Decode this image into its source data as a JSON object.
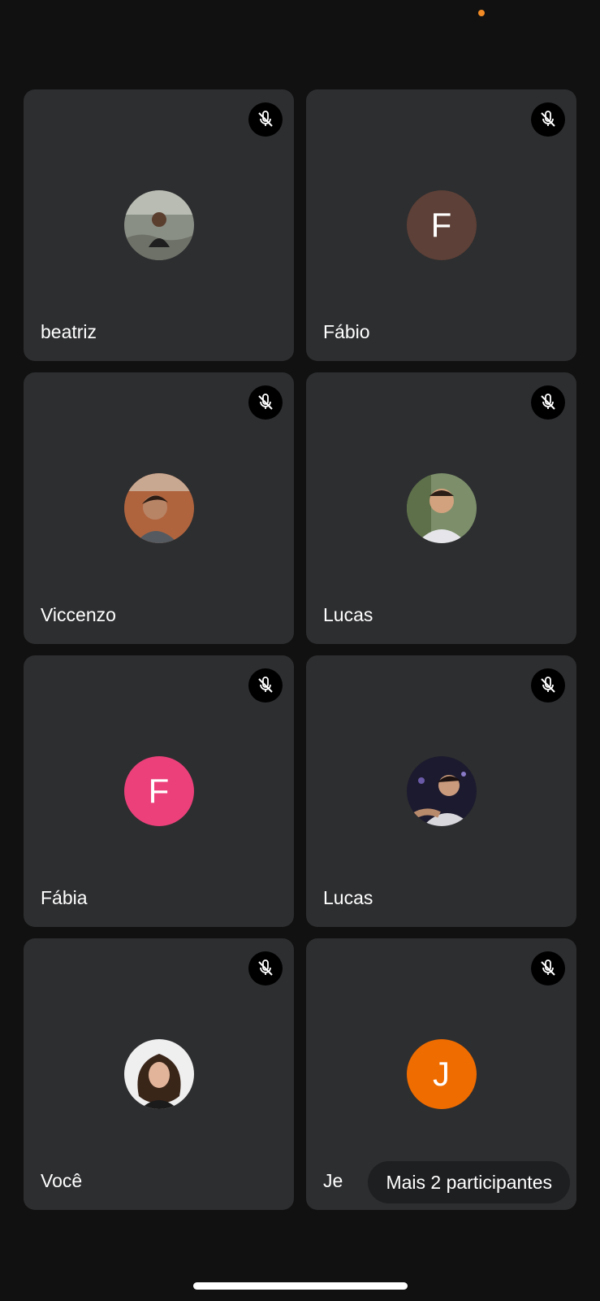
{
  "status": {
    "indicator_color": "#f28b25"
  },
  "participants": [
    {
      "name": "beatriz",
      "avatar": {
        "type": "photo"
      }
    },
    {
      "name": "Fábio",
      "avatar": {
        "type": "initial",
        "letter": "F",
        "color": "#5d4037"
      }
    },
    {
      "name": "Viccenzo",
      "avatar": {
        "type": "photo"
      }
    },
    {
      "name": "Lucas",
      "avatar": {
        "type": "photo"
      }
    },
    {
      "name": "Fábia",
      "avatar": {
        "type": "initial",
        "letter": "F",
        "color": "#ec407a"
      }
    },
    {
      "name": "Lucas",
      "avatar": {
        "type": "photo"
      }
    },
    {
      "name": "Você",
      "avatar": {
        "type": "photo"
      }
    },
    {
      "name": "Je",
      "avatar": {
        "type": "initial",
        "letter": "J",
        "color": "#ef6c00"
      }
    }
  ],
  "mute_icon": "mic-off-icon",
  "more_participants_label": "Mais 2 participantes"
}
